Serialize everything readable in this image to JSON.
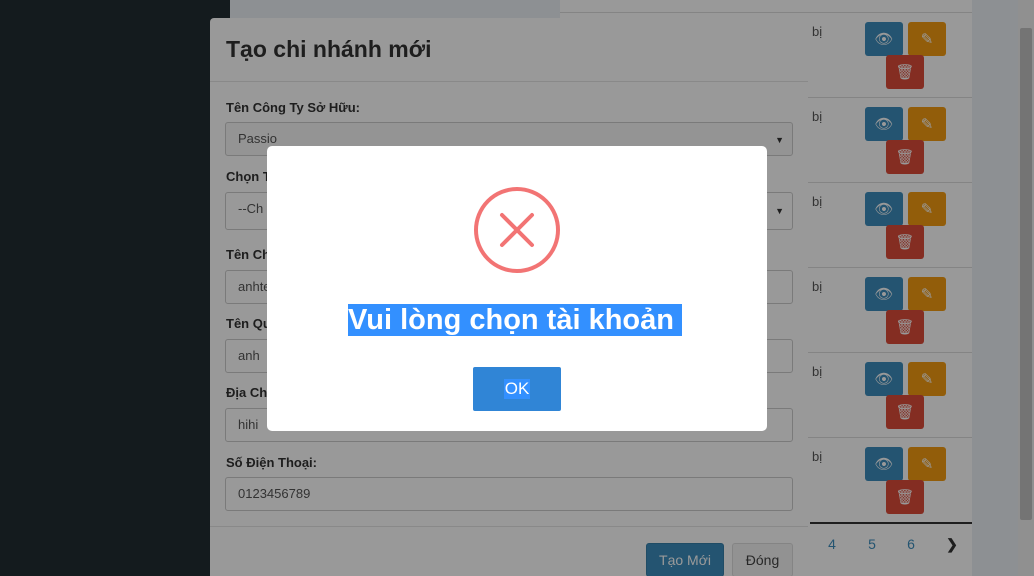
{
  "background_table": {
    "row_text": "bị",
    "pagination": [
      "4",
      "5",
      "6"
    ],
    "next_icon": "chevron-right-icon"
  },
  "create_branch_modal": {
    "title": "Tạo chi nhánh mới",
    "fields": {
      "owner_company_label": "Tên Công Ty Sở Hữu:",
      "owner_company_value": "Passio",
      "account_label": "Chọn T",
      "account_value": "--Ch",
      "branch_name_label": "Tên Ch",
      "branch_name_value": "anhte",
      "manager_label": "Tên Qu",
      "manager_value": "anh",
      "address_label": "Địa Ch",
      "address_value": "hihi",
      "phone_label": "Số Điện Thoại:",
      "phone_value": "0123456789"
    },
    "create_button": "Tạo Mới",
    "close_button": "Đóng"
  },
  "alert": {
    "icon": "error-x-icon",
    "message": "Vui lòng chọn tài khoản",
    "ok_button": "OK",
    "colors": {
      "icon": "#f27474",
      "button": "#3085d6",
      "selection": "#3390ff"
    }
  }
}
